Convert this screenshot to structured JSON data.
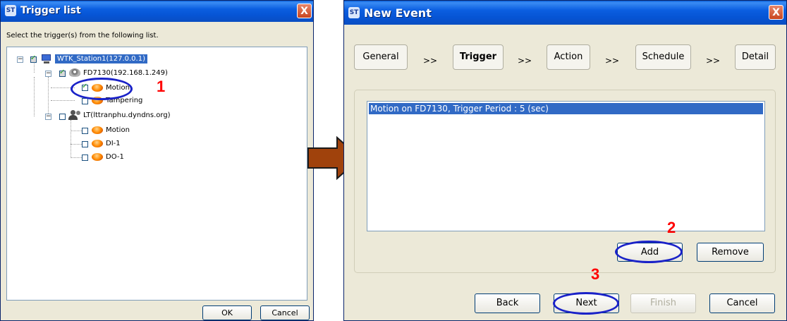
{
  "trigger_list": {
    "title": "Trigger list",
    "instruction": "Select the trigger(s) from the following list.",
    "tree": {
      "station": "WTK_Station1(127.0.0.1)",
      "device1": "FD7130(192.168.1.249)",
      "device1_items": [
        "Motion",
        "Tampering"
      ],
      "device2": "LT(lttranphu.dyndns.org)",
      "device2_items": [
        "Motion",
        "DI-1",
        "DO-1"
      ]
    },
    "ok_label": "OK",
    "cancel_label": "Cancel",
    "close_glyph": "X"
  },
  "new_event": {
    "title": "New Event",
    "tabs": [
      "General",
      "Trigger",
      "Action",
      "Schedule",
      "Detail"
    ],
    "active_tab": "Trigger",
    "separator": ">>",
    "list_items": [
      "Motion on FD7130, Trigger Period : 5 (sec)"
    ],
    "add_label": "Add",
    "remove_label": "Remove",
    "back_label": "Back",
    "next_label": "Next",
    "finish_label": "Finish",
    "cancel_label": "Cancel",
    "close_glyph": "X"
  },
  "app_icon_text": "ST",
  "annotations": {
    "step1": "1",
    "step2": "2",
    "step3": "3"
  },
  "colors": {
    "annotation_red": "#ff0000",
    "ellipse_blue": "#1a22c8",
    "arrow_brown": "#a0420c",
    "title_blue": "#0654d4"
  }
}
